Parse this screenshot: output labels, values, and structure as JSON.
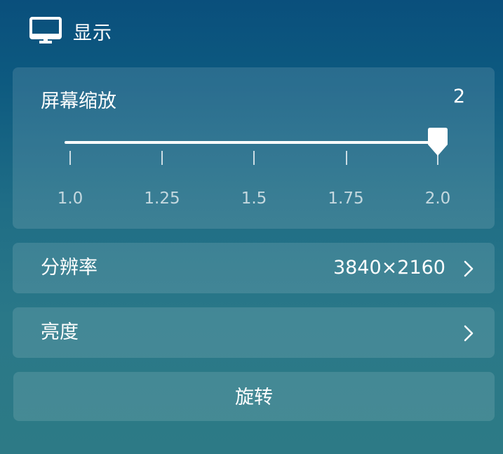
{
  "header": {
    "icon": "monitor-icon",
    "title": "显示"
  },
  "scale": {
    "label": "屏幕缩放",
    "value": "2",
    "ticks": [
      "1.0",
      "1.25",
      "1.5",
      "1.75",
      "2.0"
    ],
    "selected_fraction": 1.0
  },
  "resolution": {
    "label": "分辨率",
    "value": "3840×2160",
    "icon": "chevron-right-icon"
  },
  "brightness": {
    "label": "亮度",
    "icon": "chevron-right-icon"
  },
  "rotate": {
    "label": "旋转"
  },
  "colors": {
    "background_top": "#0a4f7c",
    "background_bottom": "#2d7a86",
    "card": "#ffffff1f",
    "text": "#ffffff"
  }
}
